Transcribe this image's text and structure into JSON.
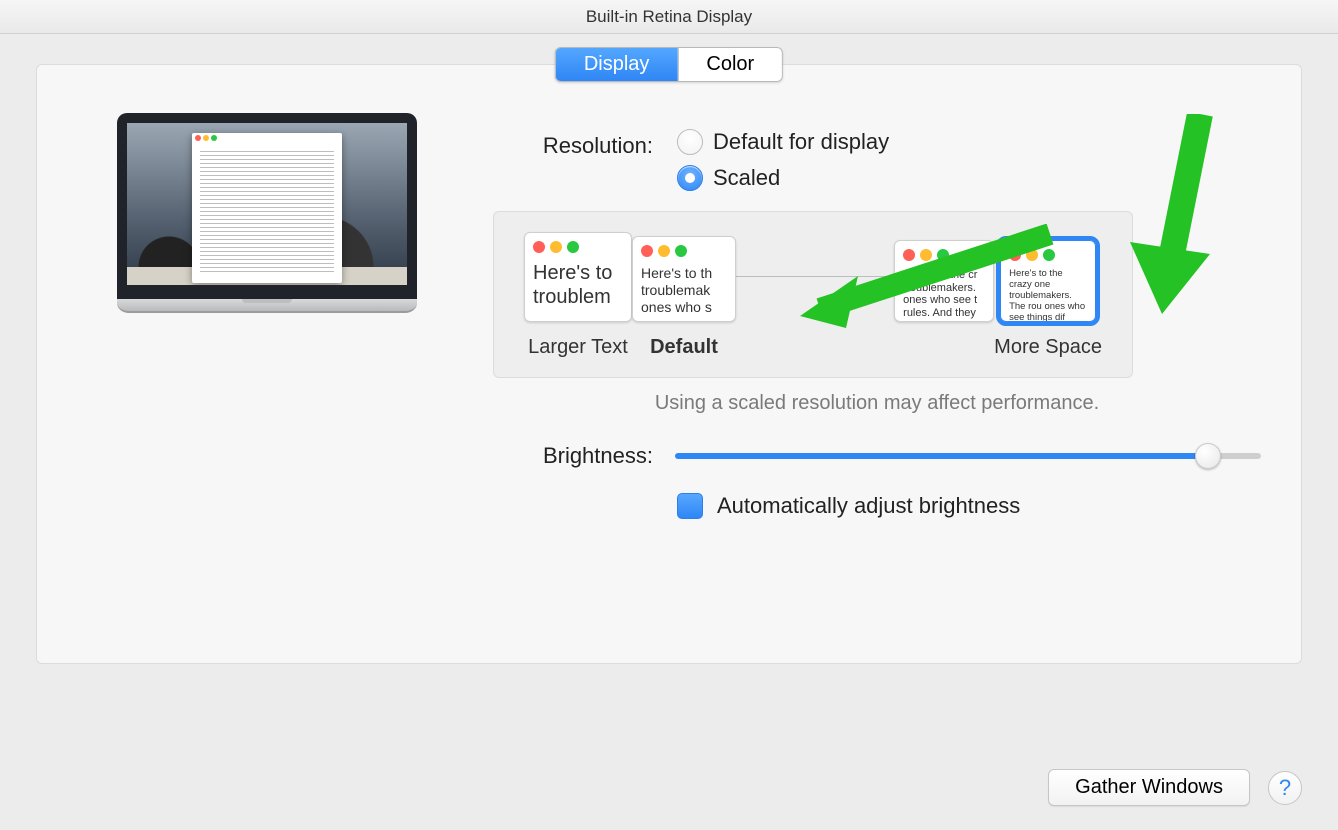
{
  "title": "Built-in Retina Display",
  "tabs": {
    "display": "Display",
    "color": "Color",
    "selected": "display"
  },
  "resolution": {
    "label": "Resolution:",
    "options": {
      "default": "Default for display",
      "scaled": "Scaled"
    },
    "selected": "scaled"
  },
  "scaled": {
    "labels": {
      "larger": "Larger Text",
      "default": "Default",
      "more": "More Space"
    },
    "selected_index": 3,
    "sample_text": {
      "xl": "Here's to troublem",
      "lg": "Here's to th troublemak ones who s",
      "md": "Here's to the cr troublemakers. ones who see t rules. And they",
      "sm": "Here's to the crazy one troublemakers. The rou ones who see things dif rules. And they have no can quote them, disagr them. About the only th Because they change t"
    },
    "note": "Using a scaled resolution may affect performance."
  },
  "brightness": {
    "label": "Brightness:",
    "value_pct": 91,
    "auto_label": "Automatically adjust brightness",
    "auto_checked": true
  },
  "gather_windows": "Gather Windows",
  "help": "?"
}
